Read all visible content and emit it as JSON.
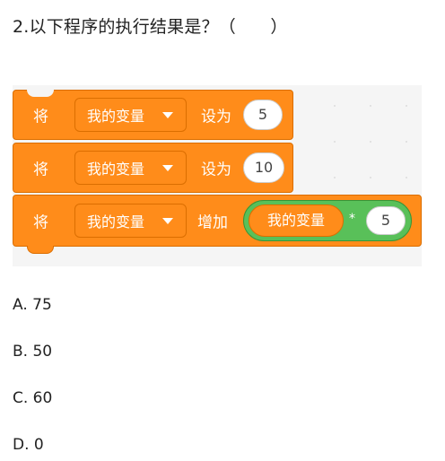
{
  "question": "2.以下程序的执行结果是？（　　）",
  "blocks": [
    {
      "label": "将",
      "variable": "我的变量",
      "action": "设为",
      "value": "5"
    },
    {
      "label": "将",
      "variable": "我的变量",
      "action": "设为",
      "value": "10"
    },
    {
      "label": "将",
      "variable": "我的变量",
      "action": "增加",
      "expression": {
        "left": "我的变量",
        "operator": "*",
        "right": "5"
      }
    }
  ],
  "options": [
    {
      "text": "A. 75"
    },
    {
      "text": "B. 50"
    },
    {
      "text": "C. 60"
    },
    {
      "text": "D. 0"
    }
  ],
  "colors": {
    "looks_orange": "#ff8c1a",
    "operator_green": "#59c059",
    "workspace": "#f5f5f5"
  }
}
